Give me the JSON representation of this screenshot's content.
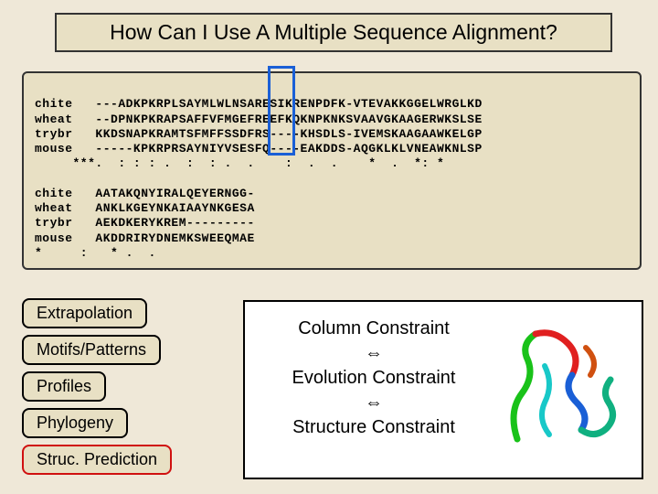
{
  "title": "How Can I Use A Multiple Sequence Alignment?",
  "alignment": {
    "block1": {
      "labels": [
        "chite",
        "wheat",
        "trybr",
        "mouse"
      ],
      "seqs": [
        "---ADKPKRPLSAYMLWLNSARESIKRENPDFK-VTEVAKKGGELWRGLKD",
        "--DPNKPKRAPSAFFVFMGEFREEFKQKNPKNKSVAAVGKAAGERWKSLSE",
        "KKDSNAPKRAMTSFMFFSSDFRS----KHSDLS-IVEMSKAAGAAWKELGP",
        "-----KPKRPRSAYNIYVSESFQ----EAKDDS-AQGKLKLVNEAWKNLSP"
      ],
      "cons": "     ***.  : : : .  :  : .  .    :  .  .    *  .  *: *"
    },
    "block2": {
      "labels": [
        "chite",
        "wheat",
        "trybr",
        "mouse"
      ],
      "seqs": [
        "AATAKQNYIRALQEYERNGG-",
        "ANKLKGEYNKAIAAYNKGESA",
        "AEKDKERYKREM---------",
        "AKDDRIRYDNEMKSWEEQMAE"
      ],
      "cons": "*     :   * .  ."
    }
  },
  "buttons": {
    "extrapolation": "Extrapolation",
    "motifs": "Motifs/Patterns",
    "profiles": "Profiles",
    "phylogeny": "Phylogeny",
    "struc": "Struc. Prediction"
  },
  "constraints": {
    "line1": "Column Constraint",
    "arrow": "⇔",
    "line2": "Evolution Constraint",
    "line3": "Structure Constraint"
  }
}
